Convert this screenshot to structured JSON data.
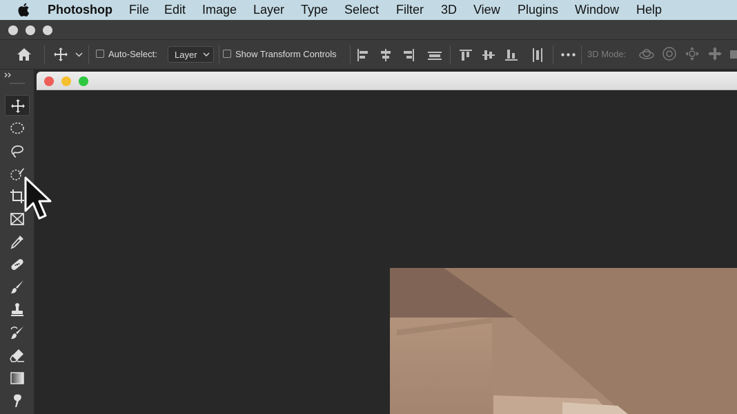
{
  "menubar": {
    "items": [
      {
        "label": "Photoshop"
      },
      {
        "label": "File"
      },
      {
        "label": "Edit"
      },
      {
        "label": "Image"
      },
      {
        "label": "Layer"
      },
      {
        "label": "Type"
      },
      {
        "label": "Select"
      },
      {
        "label": "Filter"
      },
      {
        "label": "3D"
      },
      {
        "label": "View"
      },
      {
        "label": "Plugins"
      },
      {
        "label": "Window"
      },
      {
        "label": "Help"
      }
    ]
  },
  "options_bar": {
    "auto_select_label": "Auto-Select:",
    "auto_select_checked": false,
    "layer_dropdown_value": "Layer",
    "show_transform_label": "Show Transform Controls",
    "show_transform_checked": false,
    "mode_3d_label": "3D Mode:"
  },
  "toolbar": {
    "tools": [
      {
        "icon": "move-icon",
        "active": true
      },
      {
        "icon": "elliptical-marquee-icon"
      },
      {
        "icon": "lasso-icon"
      },
      {
        "icon": "object-selection-icon"
      },
      {
        "icon": "crop-icon"
      },
      {
        "icon": "frame-icon"
      },
      {
        "icon": "eyedropper-icon"
      },
      {
        "icon": "healing-brush-icon"
      },
      {
        "icon": "brush-icon"
      },
      {
        "icon": "clone-stamp-icon"
      },
      {
        "icon": "history-brush-icon"
      },
      {
        "icon": "eraser-icon"
      },
      {
        "icon": "gradient-icon"
      },
      {
        "icon": "smudge-icon"
      }
    ]
  },
  "colors": {
    "menubar_bg": "#c3dae4",
    "panel_bg": "#3a3a3a",
    "workspace_bg": "#282828",
    "traffic_red": "#ed5f57",
    "traffic_yellow": "#f5bf2e",
    "traffic_green": "#2ec840"
  }
}
